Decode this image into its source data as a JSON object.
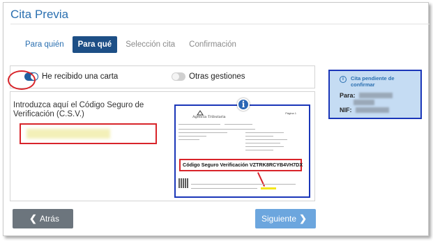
{
  "page": {
    "title": "Cita Previa"
  },
  "tabs": [
    {
      "label": "Para quién",
      "state": "link"
    },
    {
      "label": "Para qué",
      "state": "active"
    },
    {
      "label": "Selección cita",
      "state": "disabled"
    },
    {
      "label": "Confirmación",
      "state": "disabled"
    }
  ],
  "options": {
    "carta": {
      "label": "He recibido una carta",
      "checked": true
    },
    "otras": {
      "label": "Otras gestiones",
      "checked": false
    }
  },
  "form": {
    "instruction": "Introduzca aquí el Código Seguro de Verificación (C.S.V.)"
  },
  "example_letter": {
    "agency": "Agencia Tributaria",
    "page_label": "Página 1",
    "csv_label": "Código Seguro Verificación",
    "csv_value": "VZTRK8RCYB4VH7DX"
  },
  "nav": {
    "back_label": "Atrás",
    "next_label": "Siguiente"
  },
  "pending": {
    "title": "Cita pendiente de confirmar",
    "para_label": "Para:",
    "nif_label": "NIF:"
  },
  "colors": {
    "accent": "#2a6fb0",
    "active_tab": "#1d4f86",
    "highlight_red": "#d8242a",
    "border_blue": "#1a36b8",
    "pending_bg": "#c5dcf3"
  },
  "icons": [
    "info-icon",
    "chevron-left-icon",
    "chevron-right-icon",
    "toggle-icon",
    "agency-logo"
  ]
}
